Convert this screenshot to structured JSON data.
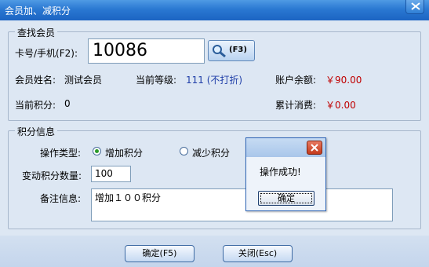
{
  "window": {
    "title": "会员加、减积分"
  },
  "find_group": {
    "legend": "查找会员",
    "card_label": "卡号/手机(F2):",
    "card_value": "10086",
    "search_shortcut": "(F3)",
    "name_label": "会员姓名:",
    "name_value": "测试会员",
    "level_label": "当前等级:",
    "level_value": "111 (不打折)",
    "balance_label": "账户余额:",
    "balance_value": "￥90.00",
    "points_label": "当前积分:",
    "points_value": "0",
    "spent_label": "累计消费:",
    "spent_value": "￥0.00"
  },
  "points_group": {
    "legend": "积分信息",
    "op_label": "操作类型:",
    "op_add": "增加积分",
    "op_sub": "减少积分",
    "op_selected": "add",
    "amount_label": "变动积分数量:",
    "amount_value": "100",
    "note_label": "备注信息:",
    "note_value": "增加１００积分"
  },
  "footer": {
    "ok_label": "确定(F5)",
    "close_label": "关闭(Esc)"
  },
  "message_box": {
    "text": "操作成功!",
    "ok_label": "确定"
  },
  "colors": {
    "titlebar": "#2a78d2",
    "money": "#c00000",
    "level": "#1f3ea8"
  }
}
